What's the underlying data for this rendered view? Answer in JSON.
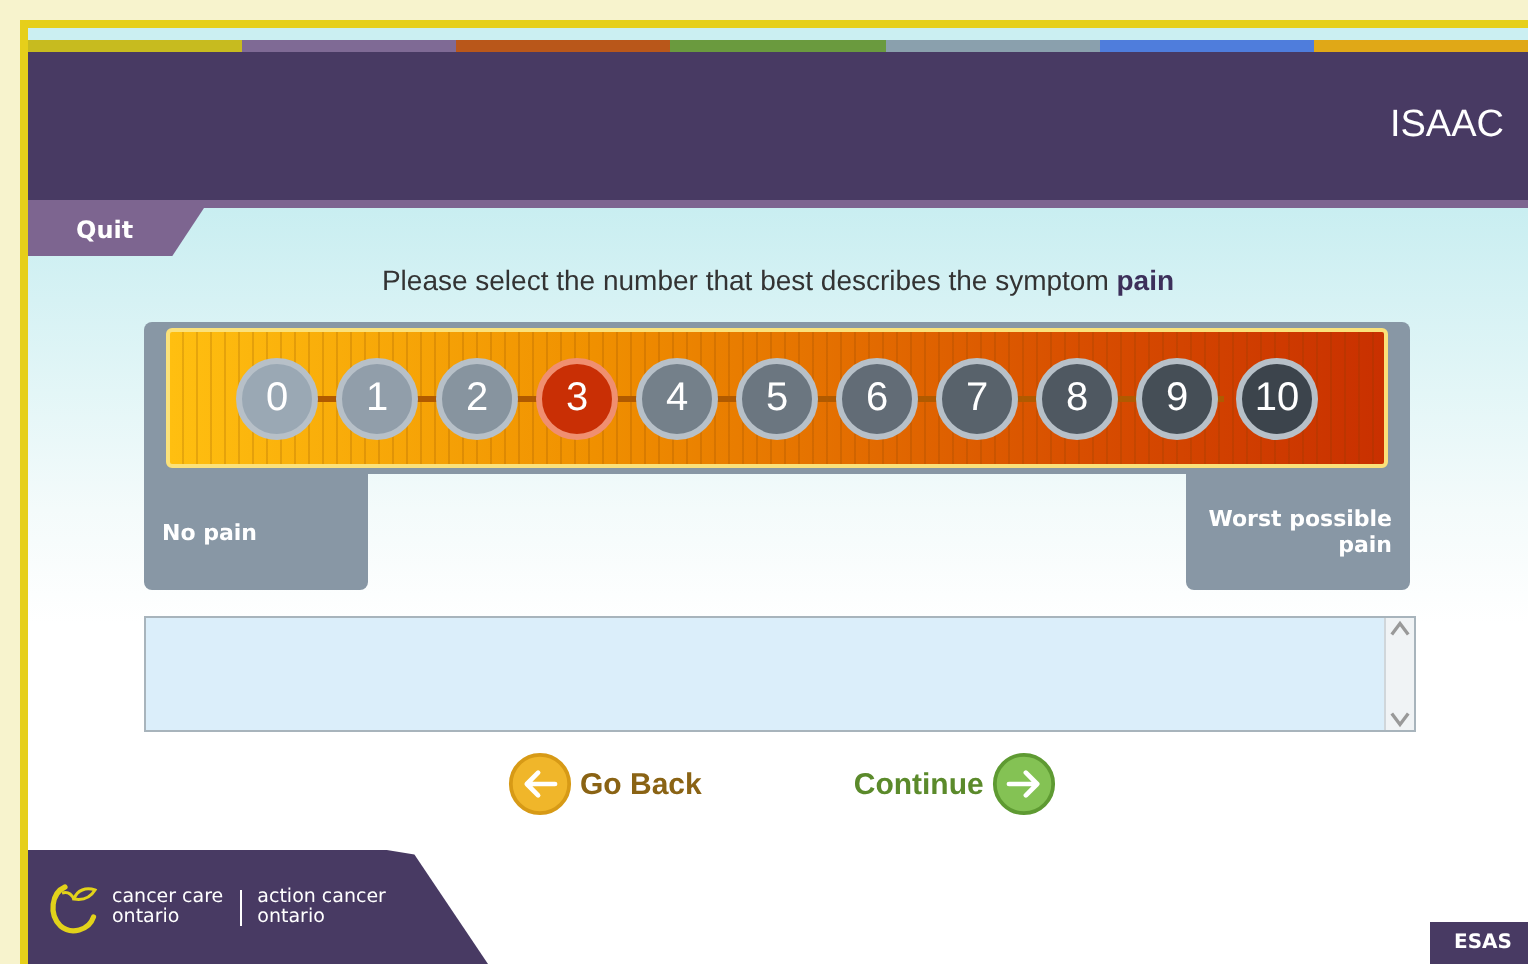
{
  "header": {
    "title": "ISAAC"
  },
  "quit_button": "Quit",
  "prompt": "Please select the number that best describes the symptom **pain**",
  "scale": {
    "options": [
      {
        "label": "0",
        "selected": false
      },
      {
        "label": "1",
        "selected": false
      },
      {
        "label": "2",
        "selected": false
      },
      {
        "label": "3",
        "selected": true
      },
      {
        "label": "4",
        "selected": false
      },
      {
        "label": "5",
        "selected": false
      },
      {
        "label": "6",
        "selected": false
      },
      {
        "label": "7",
        "selected": false
      },
      {
        "label": "8",
        "selected": false
      },
      {
        "label": "9",
        "selected": false
      },
      {
        "label": "10",
        "selected": false
      }
    ],
    "min_label": "No pain",
    "max_label": "Worst possible pain"
  },
  "buttons": [
    {
      "kind": "back",
      "label": "Go Back"
    },
    {
      "kind": "next",
      "label": "Continue"
    }
  ],
  "footer": {
    "logo_lines": [
      "cancer care",
      "ontario"
    ],
    "logo_lines_2": [
      "action cancer",
      "ontario"
    ],
    "badge": "ESAS"
  }
}
